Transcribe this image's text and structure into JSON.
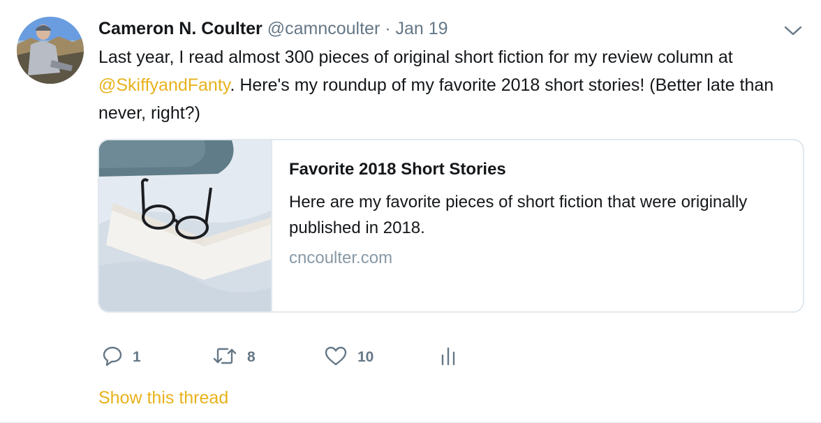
{
  "tweet": {
    "author_name": "Cameron N. Coulter",
    "author_handle": "@camncoulter",
    "separator": "·",
    "date": "Jan 19",
    "text_part1": "Last year, I read almost 300 pieces of original short fiction for my review column at ",
    "mention": "@SkiffyandFanty",
    "text_part2": ". Here's my roundup of my favorite 2018 short stories! (Better late than never, right?)"
  },
  "card": {
    "title": "Favorite 2018 Short Stories",
    "description": "Here are my favorite pieces of short fiction that were originally published in 2018.",
    "domain": "cncoulter.com"
  },
  "actions": {
    "reply_count": "1",
    "retweet_count": "8",
    "like_count": "10"
  },
  "footer": {
    "show_thread": "Show this thread"
  },
  "icons": {
    "reply": "reply-icon",
    "retweet": "retweet-icon",
    "like": "heart-icon",
    "analytics": "analytics-icon",
    "more": "chevron-down-icon"
  },
  "colors": {
    "accent": "#e8b21c",
    "secondary_text": "#657786",
    "domain_text": "#8899a6",
    "border": "#e1e8ed"
  }
}
